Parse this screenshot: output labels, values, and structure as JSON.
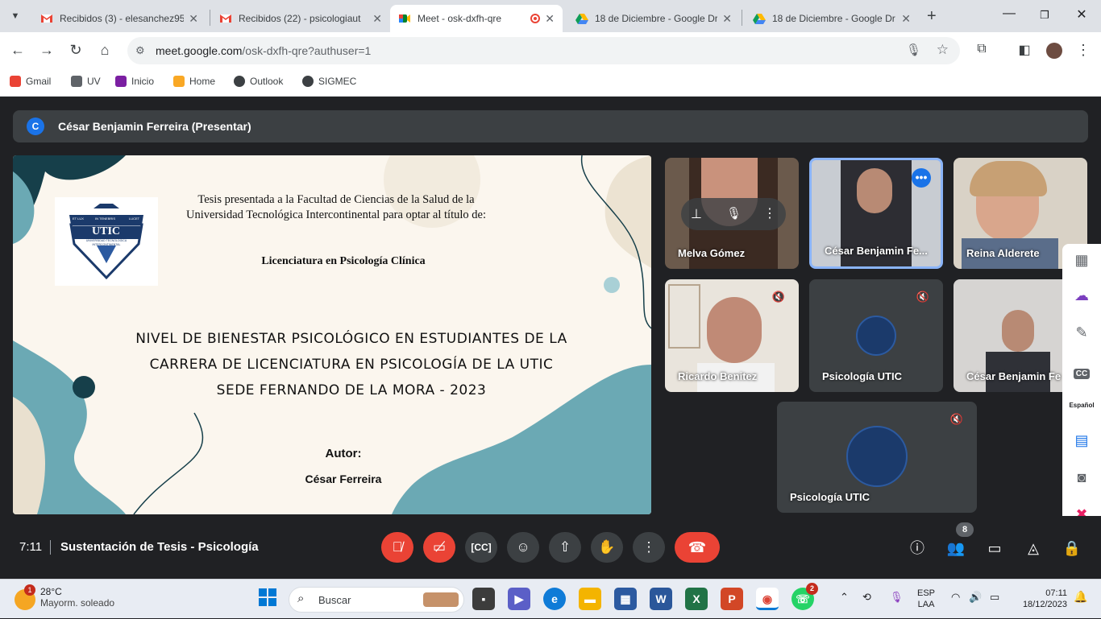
{
  "browser": {
    "tabs": [
      {
        "title": "Recibidos (3) - elesanchez95",
        "icon": "gmail-icon"
      },
      {
        "title": "Recibidos (22) - psicologiaut",
        "icon": "gmail-icon"
      },
      {
        "title": "Meet - osk-dxfh-qre",
        "icon": "meet-icon",
        "active": true
      },
      {
        "title": "18 de Diciembre - Google Dr",
        "icon": "drive-icon"
      },
      {
        "title": "18 de Diciembre - Google Dr",
        "icon": "drive-icon"
      }
    ],
    "url_host": "meet.google.com",
    "url_path": "/osk-dxfh-qre?authuser=1",
    "bookmarks": [
      "Gmail",
      "UV",
      "Inicio",
      "Home",
      "Outlook",
      "SIGMEC"
    ]
  },
  "meet": {
    "presenter_initial": "C",
    "presenter_banner": "César Benjamin Ferreira (Presentar)",
    "slide": {
      "intro": "Tesis presentada a la Facultad de Ciencias de la Salud de la Universidad Tecnológica Intercontinental para optar al título de:",
      "degree": "Licenciatura en Psicología Clínica",
      "title_line1": "NIVEL DE BIENESTAR PSICOLÓGICO EN ESTUDIANTES DE LA",
      "title_line2": "CARRERA DE LICENCIATURA EN PSICOLOGÍA DE LA UTIC",
      "title_line3": "SEDE FERNANDO DE LA MORA - 2023",
      "author_label": "Autor:",
      "author_name": "César Ferreira",
      "logo_text": "UTIC",
      "logo_sub": "UNIVERSIDAD TECNOLOGICA INTERCONTINENTAL",
      "logo_motto_left": "ET LUX",
      "logo_motto_center": "IN TENEBRIS",
      "logo_motto_right": "LUCET"
    },
    "participants": [
      {
        "name": "Melva Gómez"
      },
      {
        "name": "César Benjamin Fe..."
      },
      {
        "name": "Reina Alderete"
      },
      {
        "name": "Ricardo Benitez"
      },
      {
        "name": "Psicología UTIC"
      },
      {
        "name": "César Benjamin Fe"
      },
      {
        "name": "Psicología UTIC"
      }
    ],
    "time": "7:11",
    "meeting_title": "Sustentación de Tesis - Psicología",
    "participant_count": "8",
    "side_panel_language": "Español",
    "side_panel_cc": "CC"
  },
  "taskbar": {
    "weather_temp": "28°C",
    "weather_desc": "Mayorm. soleado",
    "weather_badge": "1",
    "search_placeholder": "Buscar",
    "whatsapp_badge": "2",
    "lang_top": "ESP",
    "lang_bottom": "LAA",
    "clock_time": "07:11",
    "clock_date": "18/12/2023"
  }
}
